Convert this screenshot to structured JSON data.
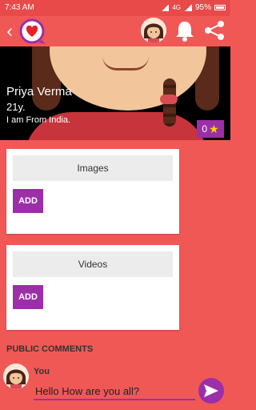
{
  "status_bar": {
    "time": "7:43 AM",
    "network": "4G",
    "battery": "95%"
  },
  "profile": {
    "name": "Priya Verma",
    "age": "21y.",
    "description": "I am From India.",
    "stars": "0"
  },
  "images_card": {
    "title": "Images",
    "add_label": "ADD"
  },
  "videos_card": {
    "title": "Videos",
    "add_label": "ADD"
  },
  "comments": {
    "section_title": "PUBLIC COMMENTS",
    "author": "You",
    "input_value": "Hello How are you all?"
  },
  "colors": {
    "primary": "#f05856",
    "accent": "#9b2fa8",
    "star": "#ffd600"
  }
}
